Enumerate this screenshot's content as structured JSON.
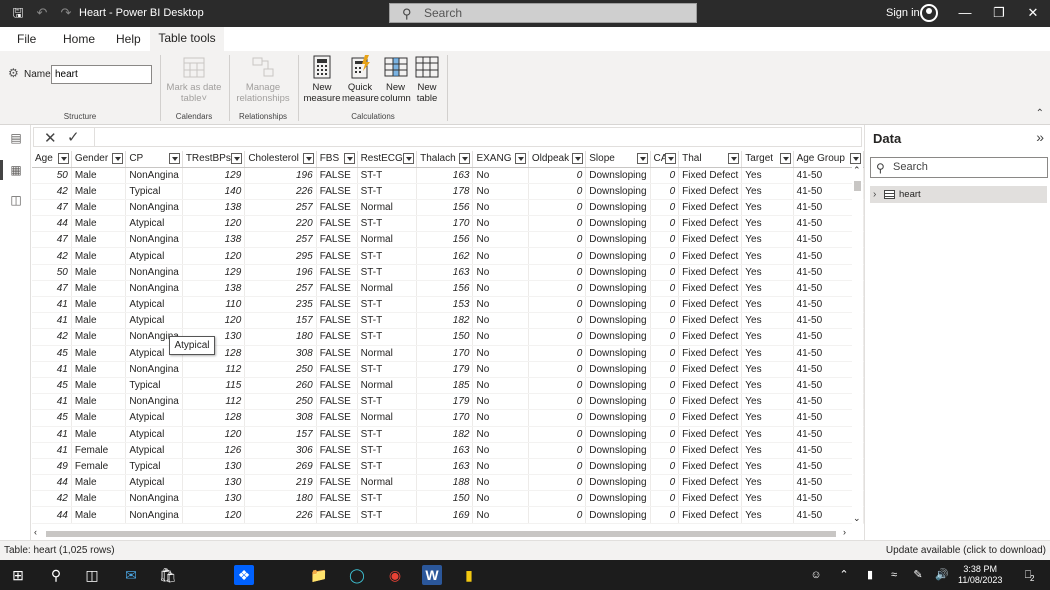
{
  "titlebar": {
    "title": "Heart - Power BI Desktop",
    "search": "Search",
    "signin": "Sign in"
  },
  "menu": {
    "file": "File",
    "home": "Home",
    "help": "Help",
    "table_tools": "Table tools"
  },
  "ribbon": {
    "name_label": "Name",
    "name_value": "heart",
    "mark_as_date_l1": "Mark as date",
    "mark_as_date_l2": "table",
    "manage_rel_l1": "Manage",
    "manage_rel_l2": "relationships",
    "new_measure_l1": "New",
    "new_measure_l2": "measure",
    "quick_measure_l1": "Quick",
    "quick_measure_l2": "measure",
    "new_column_l1": "New",
    "new_column_l2": "column",
    "new_table_l1": "New",
    "new_table_l2": "table",
    "groups": {
      "structure": "Structure",
      "calendars": "Calendars",
      "relationships": "Relationships",
      "calculations": "Calculations"
    }
  },
  "table": {
    "columns": [
      "Age",
      "Gender",
      "CP",
      "TRestBPs",
      "Cholesterol",
      "FBS",
      "RestECG",
      "Thalach",
      "EXANG",
      "Oldpeak",
      "Slope",
      "CA",
      "Thal",
      "Target",
      "Age Group"
    ],
    "rows": [
      [
        "50",
        "Male",
        "NonAngina",
        "129",
        "196",
        "FALSE",
        "ST-T",
        "163",
        "No",
        "0",
        "Downsloping",
        "0",
        "Fixed Defect",
        "Yes",
        "41-50"
      ],
      [
        "42",
        "Male",
        "Typical",
        "140",
        "226",
        "FALSE",
        "ST-T",
        "178",
        "No",
        "0",
        "Downsloping",
        "0",
        "Fixed Defect",
        "Yes",
        "41-50"
      ],
      [
        "47",
        "Male",
        "NonAngina",
        "138",
        "257",
        "FALSE",
        "Normal",
        "156",
        "No",
        "0",
        "Downsloping",
        "0",
        "Fixed Defect",
        "Yes",
        "41-50"
      ],
      [
        "44",
        "Male",
        "Atypical",
        "120",
        "220",
        "FALSE",
        "ST-T",
        "170",
        "No",
        "0",
        "Downsloping",
        "0",
        "Fixed Defect",
        "Yes",
        "41-50"
      ],
      [
        "47",
        "Male",
        "NonAngina",
        "138",
        "257",
        "FALSE",
        "Normal",
        "156",
        "No",
        "0",
        "Downsloping",
        "0",
        "Fixed Defect",
        "Yes",
        "41-50"
      ],
      [
        "42",
        "Male",
        "Atypical",
        "120",
        "295",
        "FALSE",
        "ST-T",
        "162",
        "No",
        "0",
        "Downsloping",
        "0",
        "Fixed Defect",
        "Yes",
        "41-50"
      ],
      [
        "50",
        "Male",
        "NonAngina",
        "129",
        "196",
        "FALSE",
        "ST-T",
        "163",
        "No",
        "0",
        "Downsloping",
        "0",
        "Fixed Defect",
        "Yes",
        "41-50"
      ],
      [
        "47",
        "Male",
        "NonAngina",
        "138",
        "257",
        "FALSE",
        "Normal",
        "156",
        "No",
        "0",
        "Downsloping",
        "0",
        "Fixed Defect",
        "Yes",
        "41-50"
      ],
      [
        "41",
        "Male",
        "Atypical",
        "110",
        "235",
        "FALSE",
        "ST-T",
        "153",
        "No",
        "0",
        "Downsloping",
        "0",
        "Fixed Defect",
        "Yes",
        "41-50"
      ],
      [
        "41",
        "Male",
        "Atypical",
        "120",
        "157",
        "FALSE",
        "ST-T",
        "182",
        "No",
        "0",
        "Downsloping",
        "0",
        "Fixed Defect",
        "Yes",
        "41-50"
      ],
      [
        "42",
        "Male",
        "NonAngina",
        "130",
        "180",
        "FALSE",
        "ST-T",
        "150",
        "No",
        "0",
        "Downsloping",
        "0",
        "Fixed Defect",
        "Yes",
        "41-50"
      ],
      [
        "45",
        "Male",
        "Atypical",
        "128",
        "308",
        "FALSE",
        "Normal",
        "170",
        "No",
        "0",
        "Downsloping",
        "0",
        "Fixed Defect",
        "Yes",
        "41-50"
      ],
      [
        "41",
        "Male",
        "NonAngina",
        "112",
        "250",
        "FALSE",
        "ST-T",
        "179",
        "No",
        "0",
        "Downsloping",
        "0",
        "Fixed Defect",
        "Yes",
        "41-50"
      ],
      [
        "45",
        "Male",
        "Typical",
        "115",
        "260",
        "FALSE",
        "Normal",
        "185",
        "No",
        "0",
        "Downsloping",
        "0",
        "Fixed Defect",
        "Yes",
        "41-50"
      ],
      [
        "41",
        "Male",
        "NonAngina",
        "112",
        "250",
        "FALSE",
        "ST-T",
        "179",
        "No",
        "0",
        "Downsloping",
        "0",
        "Fixed Defect",
        "Yes",
        "41-50"
      ],
      [
        "45",
        "Male",
        "Atypical",
        "128",
        "308",
        "FALSE",
        "Normal",
        "170",
        "No",
        "0",
        "Downsloping",
        "0",
        "Fixed Defect",
        "Yes",
        "41-50"
      ],
      [
        "41",
        "Male",
        "Atypical",
        "120",
        "157",
        "FALSE",
        "ST-T",
        "182",
        "No",
        "0",
        "Downsloping",
        "0",
        "Fixed Defect",
        "Yes",
        "41-50"
      ],
      [
        "41",
        "Female",
        "Atypical",
        "126",
        "306",
        "FALSE",
        "ST-T",
        "163",
        "No",
        "0",
        "Downsloping",
        "0",
        "Fixed Defect",
        "Yes",
        "41-50"
      ],
      [
        "49",
        "Female",
        "Typical",
        "130",
        "269",
        "FALSE",
        "ST-T",
        "163",
        "No",
        "0",
        "Downsloping",
        "0",
        "Fixed Defect",
        "Yes",
        "41-50"
      ],
      [
        "44",
        "Male",
        "Atypical",
        "130",
        "219",
        "FALSE",
        "Normal",
        "188",
        "No",
        "0",
        "Downsloping",
        "0",
        "Fixed Defect",
        "Yes",
        "41-50"
      ],
      [
        "42",
        "Male",
        "NonAngina",
        "130",
        "180",
        "FALSE",
        "ST-T",
        "150",
        "No",
        "0",
        "Downsloping",
        "0",
        "Fixed Defect",
        "Yes",
        "41-50"
      ],
      [
        "44",
        "Male",
        "NonAngina",
        "120",
        "226",
        "FALSE",
        "ST-T",
        "169",
        "No",
        "0",
        "Downsloping",
        "0",
        "Fixed Defect",
        "Yes",
        "41-50"
      ]
    ]
  },
  "tooltip": "Atypical",
  "data_pane": {
    "title": "Data",
    "search_placeholder": "Search",
    "tree_item": "heart"
  },
  "status": {
    "left": "Table: heart (1,025 rows)",
    "right": "Update available (click to download)"
  },
  "taskbar": {
    "time": "3:38 PM",
    "date": "11/08/2023",
    "notifications": "2"
  }
}
